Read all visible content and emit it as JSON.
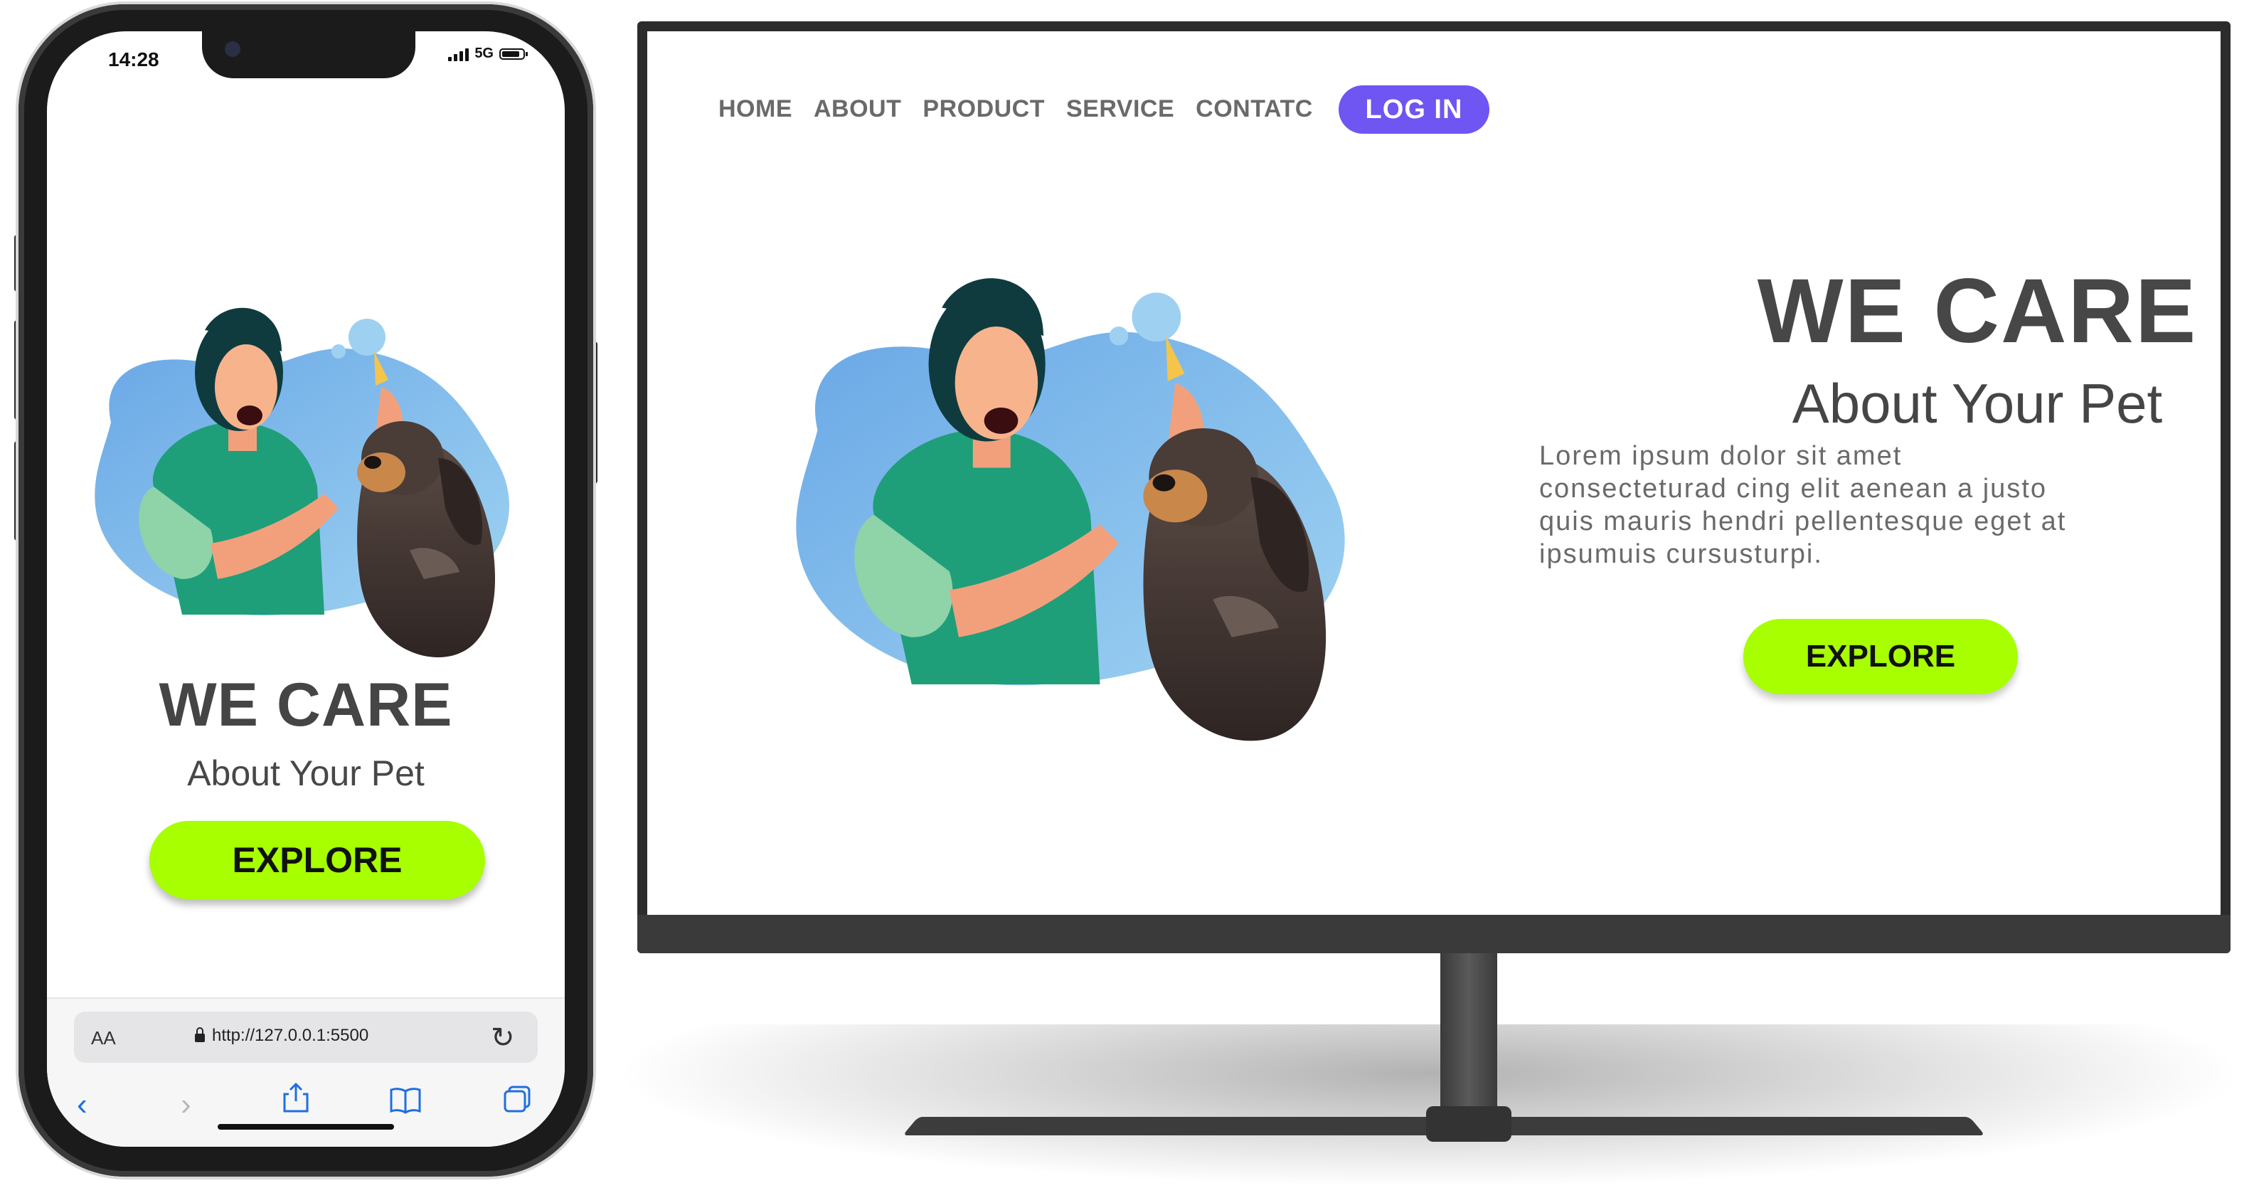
{
  "phone": {
    "status_time": "14:28",
    "network": "5G",
    "title": "WE CARE",
    "subtitle": "About Your Pet",
    "explore_label": "EXPLORE",
    "browser": {
      "text_size_label": "AA",
      "url": "http://127.0.0.1:5500",
      "icons": [
        "back-icon",
        "forward-icon",
        "share-icon",
        "bookmarks-icon",
        "tabs-icon",
        "reload-icon",
        "lock-icon"
      ]
    }
  },
  "desktop": {
    "nav": [
      "HOME",
      "ABOUT",
      "PRODUCT",
      "SERVICE",
      "CONTATC"
    ],
    "login_label": "LOG IN",
    "title": "WE CARE",
    "subtitle": "About Your Pet",
    "lorem_lines": [
      "Lorem ipsum dolor sit amet",
      "consectetur­ad cing elit aenean a justo",
      "quis mauris hendri pellentesque eget at",
      "ipsumuis cursusturpi."
    ],
    "explore_label": "EXPLORE"
  },
  "colors": {
    "accent_green": "#a7ff00",
    "login_purple": "#6f55f2",
    "heading_gray": "#474747",
    "blob_blue": "#7fb6e8",
    "shirt_green": "#1f9e7a"
  }
}
